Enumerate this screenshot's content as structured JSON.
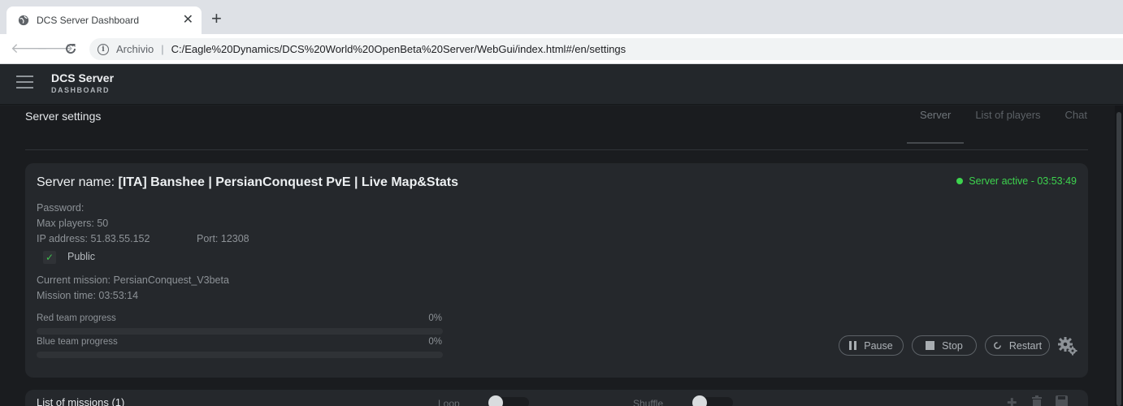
{
  "browser": {
    "tab_title": "DCS Server Dashboard",
    "tab_close": "✕",
    "new_tab": "+",
    "origin_label": "Archivio",
    "url": "C:/Eagle%20Dynamics/DCS%20World%20OpenBeta%20Server/WebGui/index.html#/en/settings"
  },
  "header": {
    "title": "DCS Server",
    "subtitle": "DASHBOARD"
  },
  "page": {
    "title": "Server settings",
    "tabs": [
      {
        "label": "Server",
        "active": true
      },
      {
        "label": "List of players",
        "active": false
      },
      {
        "label": "Chat",
        "active": false
      }
    ]
  },
  "server": {
    "name_label": "Server name: ",
    "name": "[ITA] Banshee | PersianConquest PvE | Live Map&Stats",
    "status": "Server active - 03:53:49",
    "status_color": "#3dd34e",
    "password_label": "Password:",
    "max_players": "Max players: 50",
    "ip_address": "IP address: 51.83.55.152",
    "port": "Port: 12308",
    "public_label": "Public",
    "public_checked": true,
    "current_mission": "Current mission: PersianConquest_V3beta",
    "mission_time": "Mission time: 03:53:14",
    "red_progress_label": "Red team progress",
    "red_progress_pct": "0%",
    "red_progress_value": 0,
    "blue_progress_label": "Blue team progress",
    "blue_progress_pct": "0%",
    "blue_progress_value": 0,
    "buttons": {
      "pause": "Pause",
      "stop": "Stop",
      "restart": "Restart"
    }
  },
  "missions": {
    "title": "List of missions (1)",
    "loop_label": "Loop",
    "shuffle_label": "Shuffle"
  },
  "colors": {
    "background": "#1a1c1f",
    "card": "#25282c",
    "header": "#23272b"
  }
}
